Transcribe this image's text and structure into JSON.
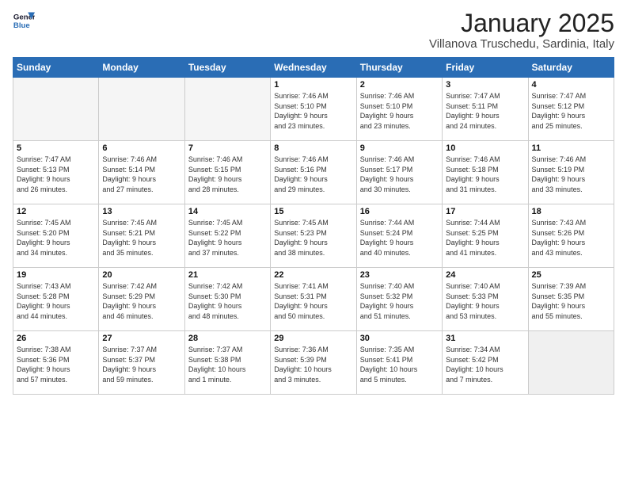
{
  "header": {
    "logo_line1": "General",
    "logo_line2": "Blue",
    "title": "January 2025",
    "subtitle": "Villanova Truschedu, Sardinia, Italy"
  },
  "days_of_week": [
    "Sunday",
    "Monday",
    "Tuesday",
    "Wednesday",
    "Thursday",
    "Friday",
    "Saturday"
  ],
  "weeks": [
    [
      {
        "num": "",
        "info": "",
        "empty": true
      },
      {
        "num": "",
        "info": "",
        "empty": true
      },
      {
        "num": "",
        "info": "",
        "empty": true
      },
      {
        "num": "1",
        "info": "Sunrise: 7:46 AM\nSunset: 5:10 PM\nDaylight: 9 hours\nand 23 minutes."
      },
      {
        "num": "2",
        "info": "Sunrise: 7:46 AM\nSunset: 5:10 PM\nDaylight: 9 hours\nand 23 minutes."
      },
      {
        "num": "3",
        "info": "Sunrise: 7:47 AM\nSunset: 5:11 PM\nDaylight: 9 hours\nand 24 minutes."
      },
      {
        "num": "4",
        "info": "Sunrise: 7:47 AM\nSunset: 5:12 PM\nDaylight: 9 hours\nand 25 minutes."
      }
    ],
    [
      {
        "num": "5",
        "info": "Sunrise: 7:47 AM\nSunset: 5:13 PM\nDaylight: 9 hours\nand 26 minutes."
      },
      {
        "num": "6",
        "info": "Sunrise: 7:46 AM\nSunset: 5:14 PM\nDaylight: 9 hours\nand 27 minutes."
      },
      {
        "num": "7",
        "info": "Sunrise: 7:46 AM\nSunset: 5:15 PM\nDaylight: 9 hours\nand 28 minutes."
      },
      {
        "num": "8",
        "info": "Sunrise: 7:46 AM\nSunset: 5:16 PM\nDaylight: 9 hours\nand 29 minutes."
      },
      {
        "num": "9",
        "info": "Sunrise: 7:46 AM\nSunset: 5:17 PM\nDaylight: 9 hours\nand 30 minutes."
      },
      {
        "num": "10",
        "info": "Sunrise: 7:46 AM\nSunset: 5:18 PM\nDaylight: 9 hours\nand 31 minutes."
      },
      {
        "num": "11",
        "info": "Sunrise: 7:46 AM\nSunset: 5:19 PM\nDaylight: 9 hours\nand 33 minutes."
      }
    ],
    [
      {
        "num": "12",
        "info": "Sunrise: 7:45 AM\nSunset: 5:20 PM\nDaylight: 9 hours\nand 34 minutes."
      },
      {
        "num": "13",
        "info": "Sunrise: 7:45 AM\nSunset: 5:21 PM\nDaylight: 9 hours\nand 35 minutes."
      },
      {
        "num": "14",
        "info": "Sunrise: 7:45 AM\nSunset: 5:22 PM\nDaylight: 9 hours\nand 37 minutes."
      },
      {
        "num": "15",
        "info": "Sunrise: 7:45 AM\nSunset: 5:23 PM\nDaylight: 9 hours\nand 38 minutes."
      },
      {
        "num": "16",
        "info": "Sunrise: 7:44 AM\nSunset: 5:24 PM\nDaylight: 9 hours\nand 40 minutes."
      },
      {
        "num": "17",
        "info": "Sunrise: 7:44 AM\nSunset: 5:25 PM\nDaylight: 9 hours\nand 41 minutes."
      },
      {
        "num": "18",
        "info": "Sunrise: 7:43 AM\nSunset: 5:26 PM\nDaylight: 9 hours\nand 43 minutes."
      }
    ],
    [
      {
        "num": "19",
        "info": "Sunrise: 7:43 AM\nSunset: 5:28 PM\nDaylight: 9 hours\nand 44 minutes."
      },
      {
        "num": "20",
        "info": "Sunrise: 7:42 AM\nSunset: 5:29 PM\nDaylight: 9 hours\nand 46 minutes."
      },
      {
        "num": "21",
        "info": "Sunrise: 7:42 AM\nSunset: 5:30 PM\nDaylight: 9 hours\nand 48 minutes."
      },
      {
        "num": "22",
        "info": "Sunrise: 7:41 AM\nSunset: 5:31 PM\nDaylight: 9 hours\nand 50 minutes."
      },
      {
        "num": "23",
        "info": "Sunrise: 7:40 AM\nSunset: 5:32 PM\nDaylight: 9 hours\nand 51 minutes."
      },
      {
        "num": "24",
        "info": "Sunrise: 7:40 AM\nSunset: 5:33 PM\nDaylight: 9 hours\nand 53 minutes."
      },
      {
        "num": "25",
        "info": "Sunrise: 7:39 AM\nSunset: 5:35 PM\nDaylight: 9 hours\nand 55 minutes."
      }
    ],
    [
      {
        "num": "26",
        "info": "Sunrise: 7:38 AM\nSunset: 5:36 PM\nDaylight: 9 hours\nand 57 minutes."
      },
      {
        "num": "27",
        "info": "Sunrise: 7:37 AM\nSunset: 5:37 PM\nDaylight: 9 hours\nand 59 minutes."
      },
      {
        "num": "28",
        "info": "Sunrise: 7:37 AM\nSunset: 5:38 PM\nDaylight: 10 hours\nand 1 minute."
      },
      {
        "num": "29",
        "info": "Sunrise: 7:36 AM\nSunset: 5:39 PM\nDaylight: 10 hours\nand 3 minutes."
      },
      {
        "num": "30",
        "info": "Sunrise: 7:35 AM\nSunset: 5:41 PM\nDaylight: 10 hours\nand 5 minutes."
      },
      {
        "num": "31",
        "info": "Sunrise: 7:34 AM\nSunset: 5:42 PM\nDaylight: 10 hours\nand 7 minutes."
      },
      {
        "num": "",
        "info": "",
        "empty": true,
        "shaded": true
      }
    ]
  ]
}
